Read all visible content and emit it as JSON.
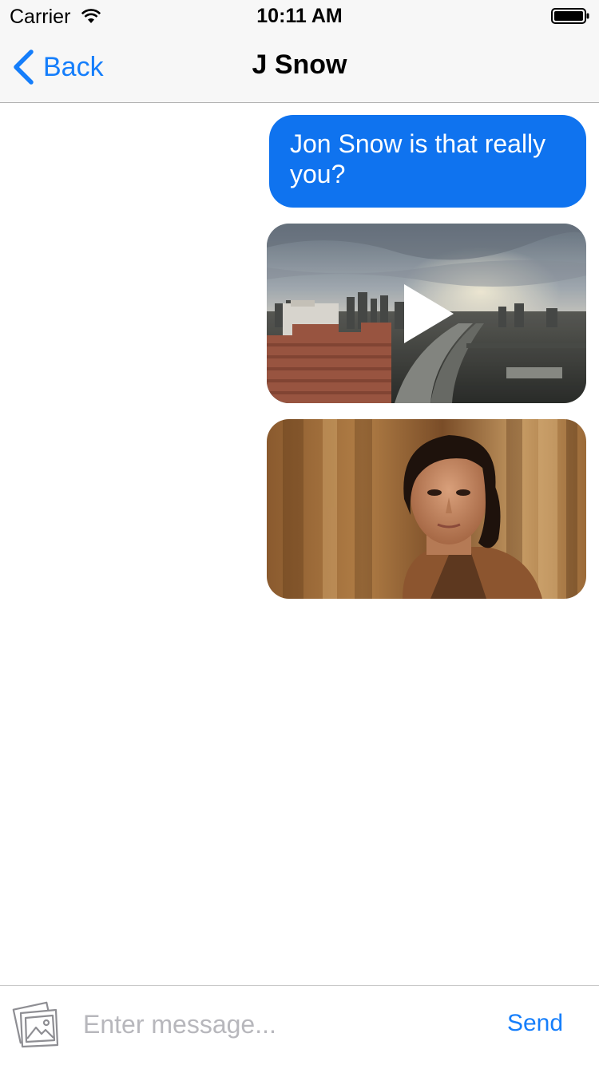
{
  "status_bar": {
    "carrier": "Carrier",
    "time": "10:11 AM",
    "wifi_icon": "wifi-icon",
    "battery_icon": "battery-full-icon"
  },
  "nav": {
    "back_label": "Back",
    "back_icon": "chevron-left-icon",
    "title": "J Snow"
  },
  "messages": [
    {
      "type": "text",
      "text": "Jon Snow is that really you?",
      "outgoing": true
    },
    {
      "type": "video",
      "thumbnail": "city-skyline-aerial",
      "play_icon": "play-icon",
      "outgoing": true
    },
    {
      "type": "photo",
      "thumbnail": "woman-portrait",
      "outgoing": true
    }
  ],
  "input_bar": {
    "media_icon": "photo-gallery-icon",
    "placeholder": "Enter message...",
    "value": "",
    "send_label": "Send"
  },
  "colors": {
    "accent": "#157efb",
    "bubble": "#0f73ef",
    "nav_background": "#f7f7f7",
    "placeholder": "#b7b7bc"
  }
}
